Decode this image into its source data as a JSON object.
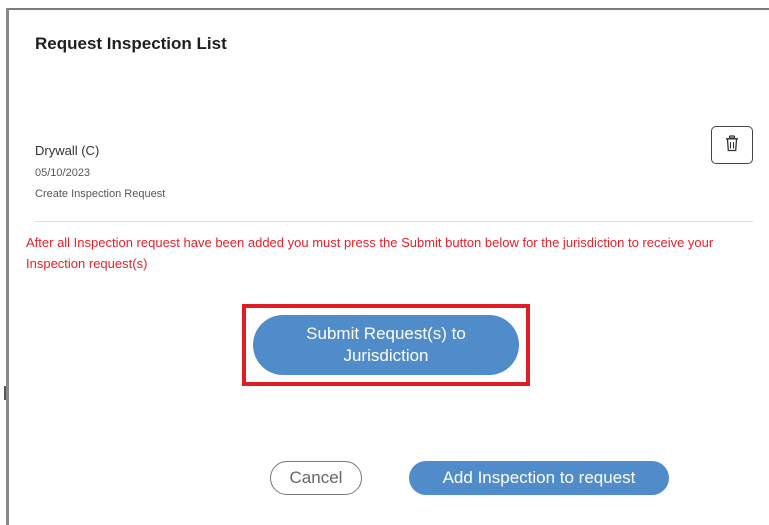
{
  "modal": {
    "title": "Request Inspection List"
  },
  "inspection_item": {
    "name": "Drywall (C)",
    "date": "05/10/2023",
    "type": "Create Inspection Request",
    "delete_icon": "trash-icon"
  },
  "warning_text": "After all Inspection request have been added you must press the Submit button below for the jurisdiction to receive your Inspection request(s)",
  "buttons": {
    "submit_label": "Submit Request(s) to Jurisdiction",
    "cancel_label": "Cancel",
    "add_label": "Add Inspection to request"
  },
  "colors": {
    "primary_button": "#4f8cc9",
    "warning_text": "#e8202a",
    "highlight_border": "#e01c24"
  }
}
